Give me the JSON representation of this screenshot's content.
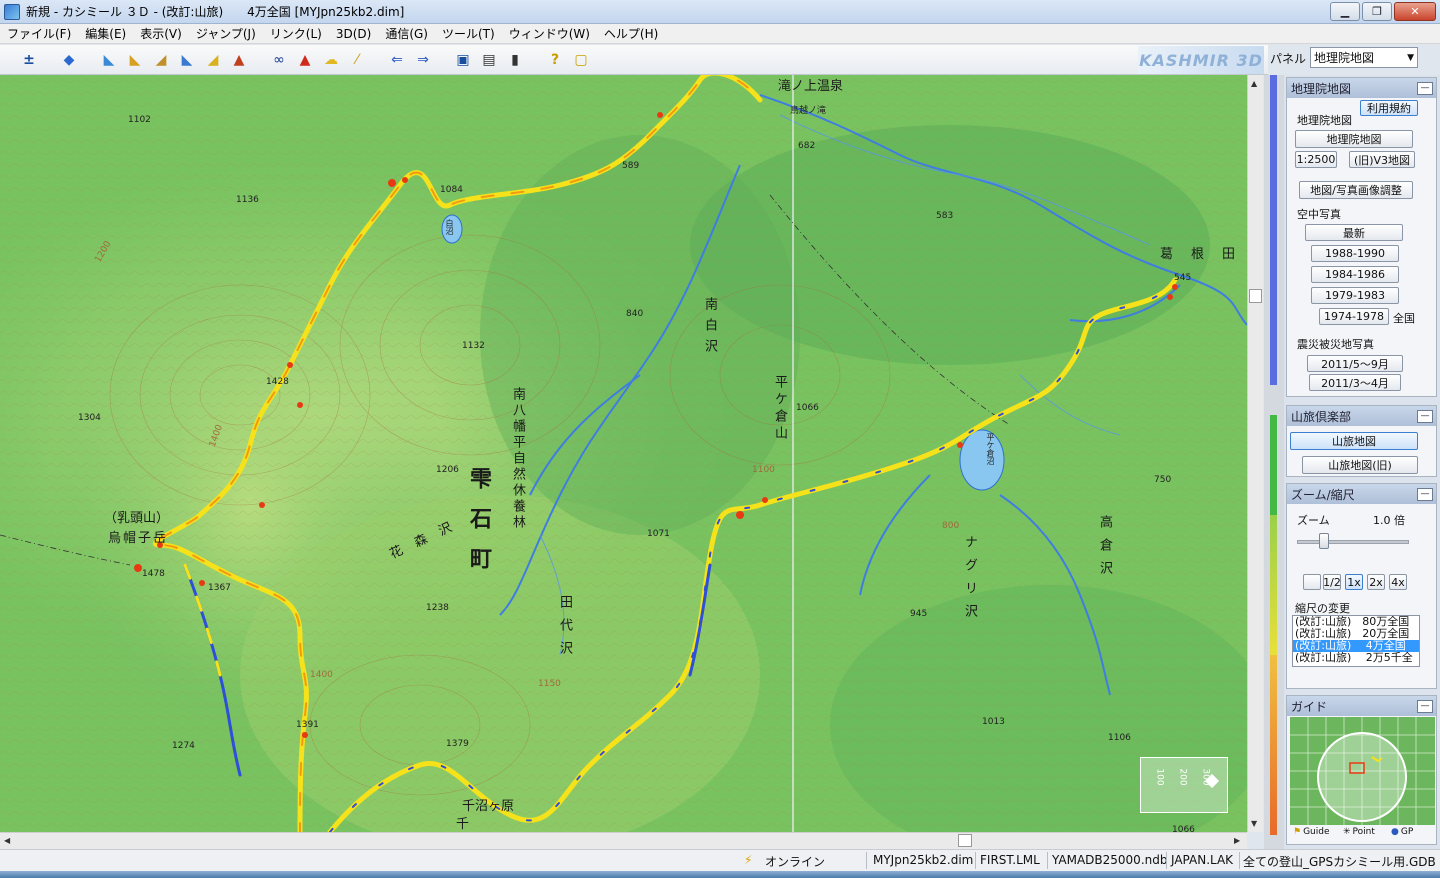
{
  "window": {
    "title": "新規 - カシミール ３Ｄ - (改訂:山旅)　　4万全国 [MYJpn25kb2.dim]"
  },
  "menu": [
    "ファイル(F)",
    "編集(E)",
    "表示(V)",
    "ジャンプ(J)",
    "リンク(L)",
    "3D(D)",
    "通信(G)",
    "ツール(T)",
    "ウィンドウ(W)",
    "ヘルプ(H)"
  ],
  "toolbar": {
    "brand": "KASHMIR 3D",
    "panel_label": "パネル",
    "panel_select": "地理院地図"
  },
  "map": {
    "labels": {
      "onsen": "滝ノ上温泉",
      "koetsu": "鳥越ノ滝",
      "chimei_kuzune": "葛根田",
      "numa_shiro": "白沼",
      "minami_shirozawa": "南白沢",
      "hirakura": "平ケ倉山",
      "hirakura_numa": "平ケ倉沼",
      "park": "南八幡平自然休養林",
      "town": "雫石町",
      "hanamori": "花森沢",
      "tashiro": "田代沢",
      "takakura": "高倉沢",
      "naguri": "ナグリ沢",
      "nyuto": "（乳頭山）",
      "eboshi": "烏帽子岳",
      "sennuma": "千沼ヶ原",
      "sennuma_prefix": "千"
    },
    "spot_heights": [
      "1102",
      "1136",
      "1084",
      "589",
      "682",
      "583",
      "545",
      "840",
      "1132",
      "1428",
      "1304",
      "1206",
      "1066",
      "1071",
      "750",
      "1478",
      "1367",
      "1238",
      "945",
      "1013",
      "1391",
      "1274",
      "1379",
      "1106",
      "1066",
      "1200",
      "800",
      "1400",
      "1100",
      "1400",
      "1150"
    ],
    "scale": [
      "100",
      "200",
      "300"
    ],
    "colors": {
      "terrain_light": "#a9d879",
      "terrain_dark": "#4ea854",
      "river": "#4a7fe0",
      "track_red": "#e83a12",
      "track_yellow": "#f6e21a",
      "track_orange": "#f39a14",
      "track_blue": "#2e4fd8"
    }
  },
  "panel": {
    "gsi": {
      "title": "地理院地図",
      "terms": "利用規約",
      "sub_title": "地理院地図",
      "btn_map": "地理院地図",
      "btn_2500": "1:2500",
      "btn_v3": "(旧)V3地図",
      "btn_adjust": "地図/写真画像調整",
      "aerial_label": "空中写真",
      "btn_latest": "最新",
      "btn_1988": "1988-1990",
      "btn_1984": "1984-1986",
      "btn_1979": "1979-1983",
      "btn_1974": "1974-1978",
      "nationwide": "全国",
      "disaster_label": "震災被災地写真",
      "btn_2011a": "2011/5～9月",
      "btn_2011b": "2011/3～4月"
    },
    "club": {
      "title": "山旅倶楽部",
      "btn_map": "山旅地図",
      "btn_old": "山旅地図(旧)"
    },
    "zoom": {
      "title": "ズーム/縮尺",
      "zoom_label": "ズーム",
      "zoom_value": "1.0 倍",
      "btn_half": "1/2",
      "btn_1x": "1x",
      "btn_2x": "2x",
      "btn_4x": "4x",
      "scale_label": "縮尺の変更",
      "scales": [
        "(改訂:山旅)　80万全国",
        "(改訂:山旅)　20万全国",
        "(改訂:山旅)　 4万全国",
        "(改訂:山旅)　 2万5千全"
      ],
      "selected_index": 2
    },
    "guide": {
      "title": "ガイド",
      "tab_guide": "Guide",
      "tab_point": "Point",
      "tab_gps": "GP"
    }
  },
  "status": {
    "online": "オンライン",
    "dim": "MYJpn25kb2.dim",
    "lml": "FIRST.LML",
    "ndb": "YAMADB25000.ndb",
    "lak": "JAPAN.LAK",
    "gdb": "全ての登山_GPSカシミール用.GDB"
  }
}
